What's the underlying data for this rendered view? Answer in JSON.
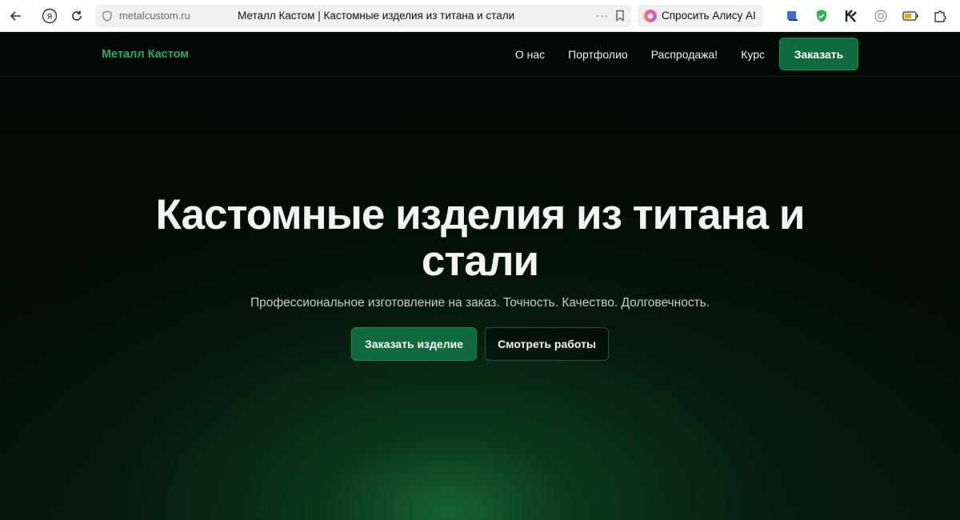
{
  "browser": {
    "url": "metalcustom.ru",
    "tab_title": "Металл Кастом | Кастомные изделия из титана и стали",
    "ya_glyph": "Я",
    "menu_dots": "···",
    "alice_label": "Спросить Алису AI"
  },
  "site": {
    "logo": "Металл Кастом",
    "nav": [
      "О нас",
      "Портфолио",
      "Распродажа!",
      "Курс"
    ],
    "nav_cta": "Заказать"
  },
  "hero": {
    "title": "Кастомные изделия из титана и стали",
    "subtitle": "Профессиональное изготовление на заказ. Точность. Качество. Долговечность.",
    "primary_button": "Заказать изделие",
    "secondary_button": "Смотреть работы"
  },
  "colors": {
    "brand_green": "#1fae60",
    "button_green": "#0f6a3d",
    "background": "#050805"
  }
}
